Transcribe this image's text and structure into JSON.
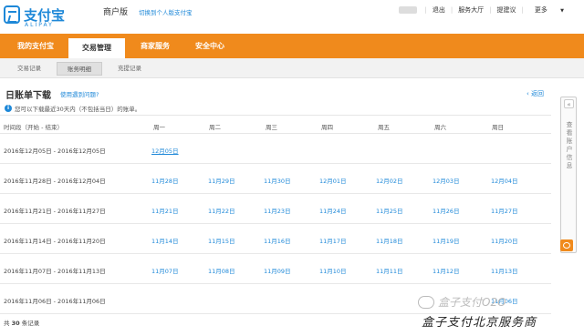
{
  "brand": {
    "logo_text": "支付宝",
    "logo_sub": "ALIPAY",
    "edition": "商户版",
    "switch_link": "切换到个人版支付宝"
  },
  "top_nav": {
    "logout": "退出",
    "service": "服务大厅",
    "suggest": "提建议",
    "more": "更多"
  },
  "main_nav": [
    "我的支付宝",
    "交易管理",
    "商家服务",
    "安全中心"
  ],
  "active_main_nav": "交易管理",
  "sub_tabs": [
    "交易记录",
    "账务明细",
    "充提记录"
  ],
  "active_sub_tab": "账务明细",
  "page": {
    "title": "日账单下载",
    "help_link": "使用遇到问题?",
    "back_link": "返回",
    "notice": "您可以下载最近30天内（不包括当日）的账单。"
  },
  "table": {
    "headers": [
      "时间段（开始 - 结束）",
      "周一",
      "周二",
      "周三",
      "周四",
      "周五",
      "周六",
      "周日"
    ],
    "rows": [
      {
        "range": "2016年12月05日 - 2016年12月05日",
        "days": [
          "12月05日",
          "",
          "",
          "",
          "",
          "",
          ""
        ]
      },
      {
        "range": "2016年11月28日 - 2016年12月04日",
        "days": [
          "11月28日",
          "11月29日",
          "11月30日",
          "12月01日",
          "12月02日",
          "12月03日",
          "12月04日"
        ]
      },
      {
        "range": "2016年11月21日 - 2016年11月27日",
        "days": [
          "11月21日",
          "11月22日",
          "11月23日",
          "11月24日",
          "11月25日",
          "11月26日",
          "11月27日"
        ]
      },
      {
        "range": "2016年11月14日 - 2016年11月20日",
        "days": [
          "11月14日",
          "11月15日",
          "11月16日",
          "11月17日",
          "11月18日",
          "11月19日",
          "11月20日"
        ]
      },
      {
        "range": "2016年11月07日 - 2016年11月13日",
        "days": [
          "11月07日",
          "11月08日",
          "11月09日",
          "11月10日",
          "11月11日",
          "11月12日",
          "11月13日"
        ]
      },
      {
        "range": "2016年11月06日 - 2016年11月06日",
        "days": [
          "",
          "",
          "",
          "",
          "",
          "",
          "11月06日"
        ]
      }
    ]
  },
  "total": {
    "prefix": "共",
    "count": "30",
    "suffix": "条记录"
  },
  "side_panel": {
    "label": "查看账户信息"
  },
  "watermark": {
    "line1": "盒子支付O2O",
    "line2": "盒子支付北京服务商"
  },
  "colors": {
    "brand_blue": "#1e88d8",
    "nav_orange": "#f08a1c"
  }
}
